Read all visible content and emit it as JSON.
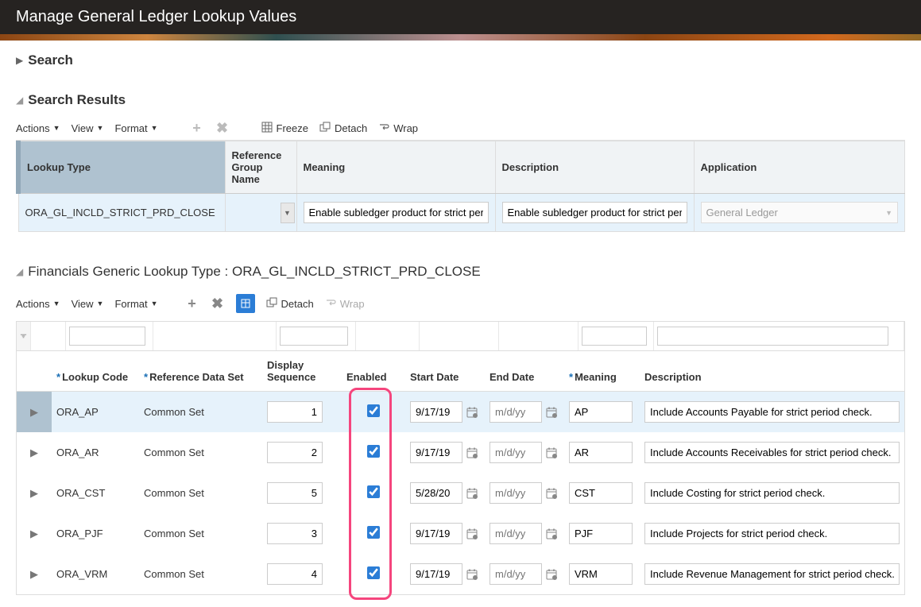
{
  "header": {
    "title": "Manage General Ledger Lookup Values"
  },
  "search": {
    "label": "Search"
  },
  "results": {
    "title": "Search Results",
    "toolbar": {
      "actions": "Actions",
      "view": "View",
      "format": "Format",
      "freeze": "Freeze",
      "detach": "Detach",
      "wrap": "Wrap"
    },
    "columns": {
      "lookup_type": "Lookup Type",
      "ref_group": "Reference Group Name",
      "meaning": "Meaning",
      "description": "Description",
      "application": "Application"
    },
    "row": {
      "lookup_type": "ORA_GL_INCLD_STRICT_PRD_CLOSE",
      "ref_group": "",
      "meaning": "Enable subledger product for strict period",
      "description": "Enable subledger product for strict period",
      "application": "General Ledger"
    }
  },
  "detail": {
    "title_prefix": "Financials Generic Lookup Type",
    "title_value": "ORA_GL_INCLD_STRICT_PRD_CLOSE",
    "toolbar": {
      "actions": "Actions",
      "view": "View",
      "format": "Format",
      "detach": "Detach",
      "wrap": "Wrap"
    },
    "columns": {
      "lookup_code": "Lookup Code",
      "ref_set": "Reference Data Set",
      "display_seq": "Display Sequence",
      "enabled": "Enabled",
      "start_date": "Start Date",
      "end_date": "End Date",
      "meaning": "Meaning",
      "description": "Description"
    },
    "end_placeholder": "m/d/yy",
    "rows": [
      {
        "code": "ORA_AP",
        "refset": "Common Set",
        "seq": "1",
        "enabled": true,
        "start": "9/17/19",
        "end": "",
        "meaning": "AP",
        "desc": "Include Accounts Payable for strict period check."
      },
      {
        "code": "ORA_AR",
        "refset": "Common Set",
        "seq": "2",
        "enabled": true,
        "start": "9/17/19",
        "end": "",
        "meaning": "AR",
        "desc": "Include Accounts Receivables for strict period check."
      },
      {
        "code": "ORA_CST",
        "refset": "Common Set",
        "seq": "5",
        "enabled": true,
        "start": "5/28/20",
        "end": "",
        "meaning": "CST",
        "desc": "Include Costing for strict period check."
      },
      {
        "code": "ORA_PJF",
        "refset": "Common Set",
        "seq": "3",
        "enabled": true,
        "start": "9/17/19",
        "end": "",
        "meaning": "PJF",
        "desc": "Include Projects for strict period check."
      },
      {
        "code": "ORA_VRM",
        "refset": "Common Set",
        "seq": "4",
        "enabled": true,
        "start": "9/17/19",
        "end": "",
        "meaning": "VRM",
        "desc": "Include Revenue Management for strict period check."
      }
    ]
  }
}
